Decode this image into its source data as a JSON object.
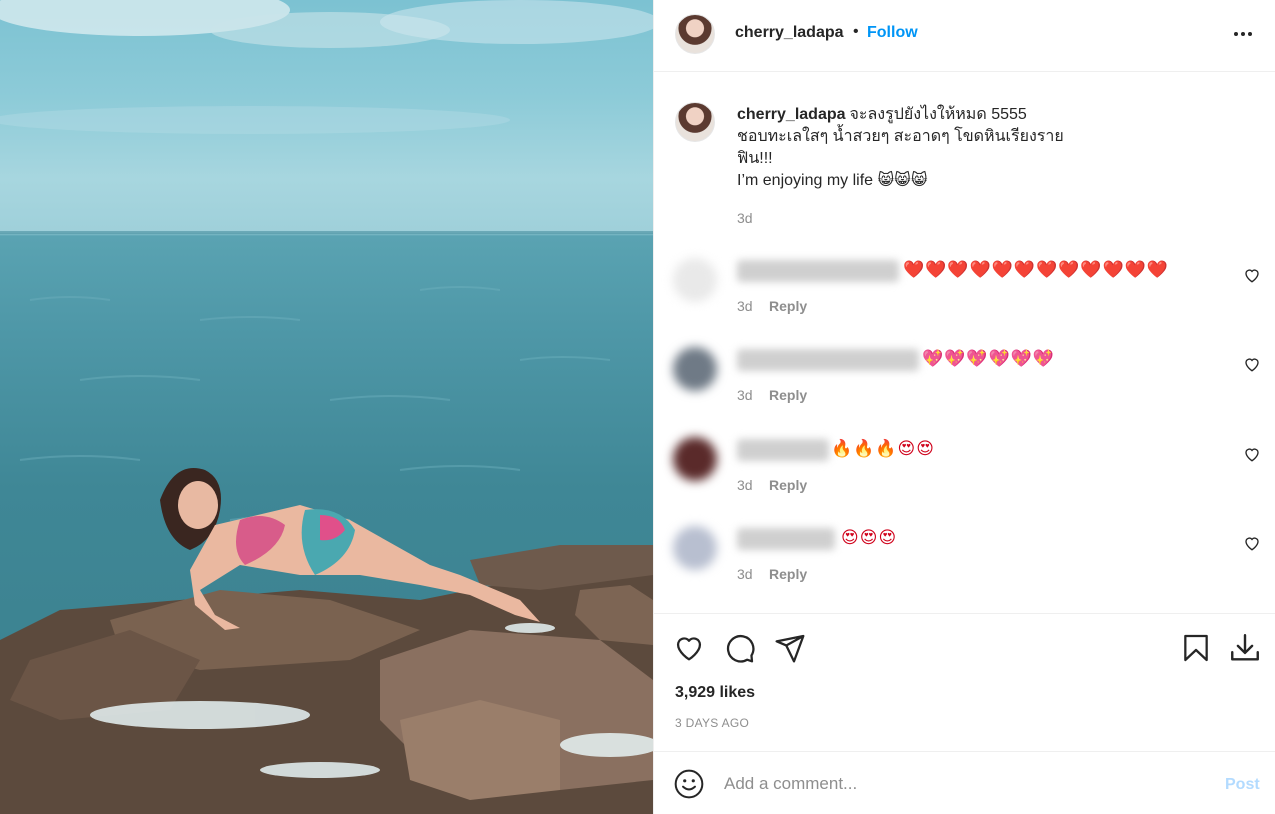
{
  "photo": {
    "alt": ""
  },
  "header": {
    "username": "cherry_ladapa",
    "separator": "•",
    "follow_label": "Follow"
  },
  "caption": {
    "username": "cherry_ladapa",
    "lines": [
      "จะลงรูปยังไงให้หมด 5555",
      "ชอบทะเลใสๆ น้ำสวยๆ สะอาดๆ โขดหินเรียงราย",
      "ฟิน!!!",
      "I’m enjoying my life 😸😸😸"
    ],
    "time": "3d"
  },
  "comments": [
    {
      "emoji": "❤️❤️❤️❤️❤️❤️❤️❤️❤️❤️❤️❤️",
      "time": "3d",
      "reply_label": "Reply",
      "avatar_color": "#e9e9e9"
    },
    {
      "emoji": "💖💖💖💖💖💖",
      "time": "3d",
      "reply_label": "Reply",
      "avatar_color": "#6f7a86"
    },
    {
      "emoji": "🔥🔥🔥😍😍",
      "time": "3d",
      "reply_label": "Reply",
      "avatar_color": "#5a2a2a"
    },
    {
      "emoji": "😍😍😍",
      "time": "3d",
      "reply_label": "Reply",
      "avatar_color": "#b8bfd0"
    }
  ],
  "actions": {
    "icons": [
      "heart-icon",
      "comment-icon",
      "share-icon",
      "bookmark-icon",
      "download-icon"
    ]
  },
  "likes": "3,929 likes",
  "posted_ago": "3 DAYS AGO",
  "add_comment": {
    "placeholder": "Add a comment...",
    "post_label": "Post"
  },
  "colors": {
    "link_blue": "#0095f6",
    "post_disabled": "#b3dbff",
    "muted_text": "#8e8e8e",
    "divider": "#efefef"
  }
}
